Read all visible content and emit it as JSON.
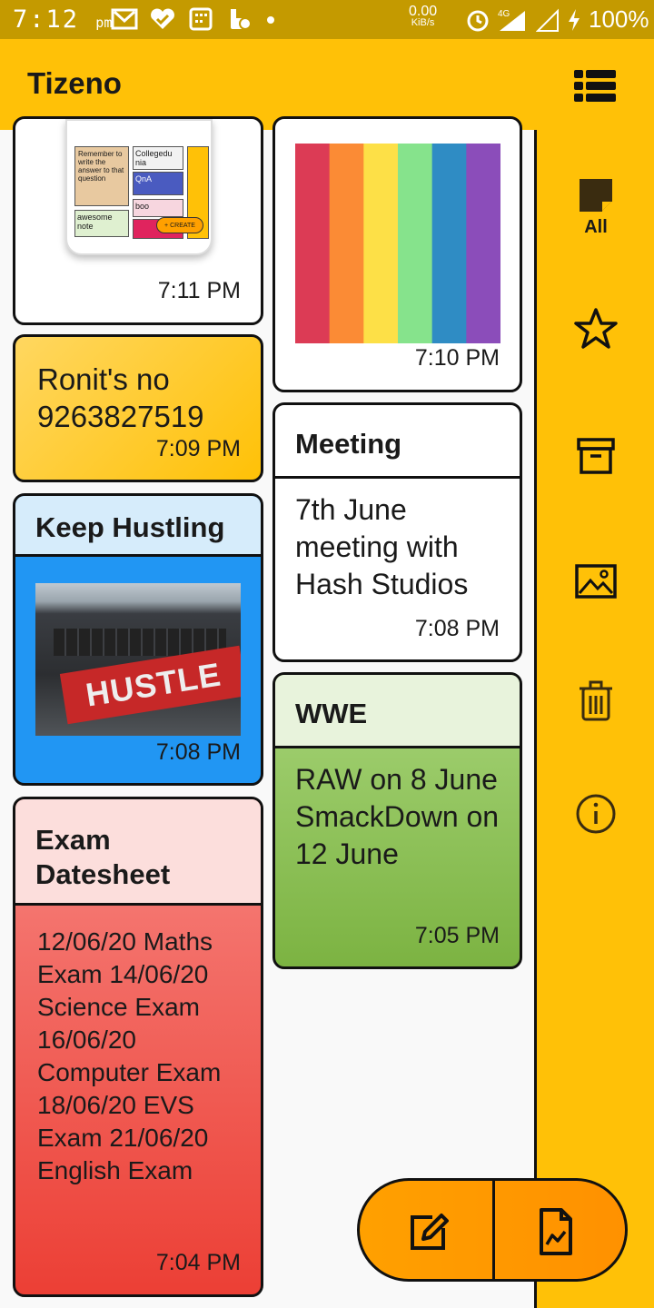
{
  "status_bar": {
    "time": "7:12",
    "ampm": "pm",
    "net_speed_value": "0.00",
    "net_speed_unit": "KiB/s",
    "network": "4G",
    "battery": "100%"
  },
  "app": {
    "title": "Tizeno"
  },
  "sidebar": {
    "items": [
      {
        "label": "All",
        "icon": "note-icon"
      },
      {
        "label": "",
        "icon": "star-icon"
      },
      {
        "label": "",
        "icon": "archive-icon"
      },
      {
        "label": "",
        "icon": "image-icon"
      },
      {
        "label": "",
        "icon": "trash-icon"
      },
      {
        "label": "",
        "icon": "info-icon"
      }
    ]
  },
  "notes": {
    "screenshot_note": {
      "time": "7:11 PM",
      "thumb": {
        "cell1": "Remember to write the answer to that question",
        "cell2": "Collegedu nia",
        "cell3": "QnA",
        "cell4": "boo",
        "cell5": "awesome note",
        "create": "+ CREATE"
      }
    },
    "rainbow_note": {
      "time": "7:10 PM",
      "colors": [
        "#DC3B55",
        "#FB8B35",
        "#FDE047",
        "#86E38C",
        "#2F8CC4",
        "#8B4DBA"
      ]
    },
    "ronit_note": {
      "body": "Ronit's no 9263827519",
      "time": "7:09 PM"
    },
    "meeting_note": {
      "title": "Meeting",
      "body": "7th June meeting with Hash Studios",
      "time": "7:08 PM"
    },
    "hustle_note": {
      "title": "Keep Hustling",
      "time": "7:08 PM",
      "sticker": "HUSTLE"
    },
    "wwe_note": {
      "title": "WWE",
      "body": "RAW on 8 June SmackDown on 12 June",
      "time": "7:05 PM"
    },
    "exam_note": {
      "title": "Exam Datesheet",
      "body": "12/06/20 Maths Exam 14/06/20 Science Exam 16/06/20 Computer Exam 18/06/20 EVS Exam 21/06/20 English Exam",
      "time": "7:04 PM"
    }
  },
  "fab": {
    "left_icon": "edit-note-icon",
    "right_icon": "image-note-icon"
  }
}
